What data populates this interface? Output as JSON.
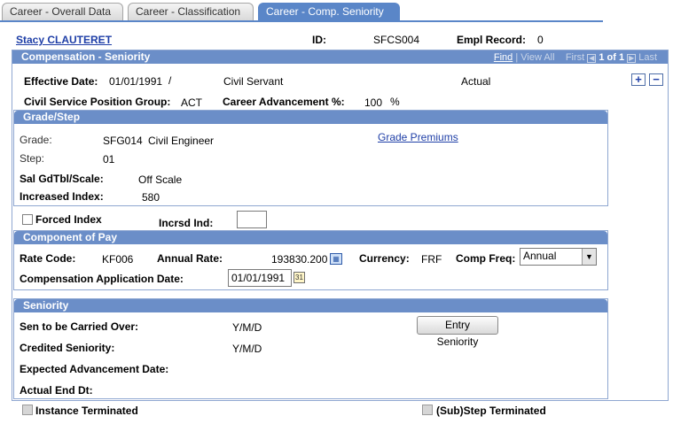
{
  "tabs": [
    {
      "label": "Career - Overall Data"
    },
    {
      "label": "Career - Classification"
    },
    {
      "label": "Career - Comp. Seniority"
    }
  ],
  "header": {
    "employee_name": "Stacy CLAUTERET",
    "id_label": "ID:",
    "id_value": "SFCS004",
    "empl_record_label": "Empl Record:",
    "empl_record_value": "0"
  },
  "comp_seniority": {
    "title": "Compensation - Seniority",
    "nav": {
      "find": "Find",
      "view_all": "View All",
      "first": "First",
      "position": "1 of 1",
      "last": "Last"
    },
    "effective_date_label": "Effective Date:",
    "effective_date_value": "01/01/1991",
    "separator": "/",
    "civil_servant": "Civil Servant",
    "actual": "Actual",
    "cs_position_group_label": "Civil Service Position Group:",
    "cs_position_group_value": "ACT",
    "career_advancement_label": "Career Advancement %:",
    "career_advancement_value": "100",
    "percent_sign": "%"
  },
  "grade_step": {
    "title": "Grade/Step",
    "grade_label": "Grade:",
    "grade_value": "SFG014",
    "grade_desc": "Civil Engineer",
    "grade_premiums_link": "Grade Premiums",
    "step_label": "Step:",
    "step_value": "01",
    "sal_label": "Sal GdTbl/Scale:",
    "sal_value": "Off Scale",
    "increased_index_label": "Increased Index:",
    "increased_index_value": "580"
  },
  "forced": {
    "forced_index_label": "Forced Index",
    "incrsd_ind_label": "Incrsd Ind:",
    "incrsd_ind_value": ""
  },
  "component_of_pay": {
    "title": "Component of Pay",
    "rate_code_label": "Rate Code:",
    "rate_code_value": "KF006",
    "annual_rate_label": "Annual Rate:",
    "annual_rate_value": "193830.200",
    "currency_label": "Currency:",
    "currency_value": "FRF",
    "comp_freq_label": "Comp Freq:",
    "comp_freq_value": "Annual",
    "comp_app_date_label": "Compensation Application Date:",
    "comp_app_date_value": "01/01/1991"
  },
  "seniority": {
    "title": "Seniority",
    "sen_carried_label": "Sen to be Carried Over:",
    "sen_carried_value": "Y/M/D",
    "entry_seniority_button": "Entry Seniority",
    "credited_label": "Credited Seniority:",
    "credited_value": "Y/M/D",
    "expected_adv_label": "Expected Advancement Date:",
    "actual_end_label": "Actual End Dt:"
  },
  "footer": {
    "instance_terminated_label": "Instance Terminated",
    "substep_terminated_label": "(Sub)Step Terminated"
  },
  "colors": {
    "header_blue": "#6b8ec8",
    "active_tab": "#5a86c8",
    "link": "#1f3fa7"
  }
}
